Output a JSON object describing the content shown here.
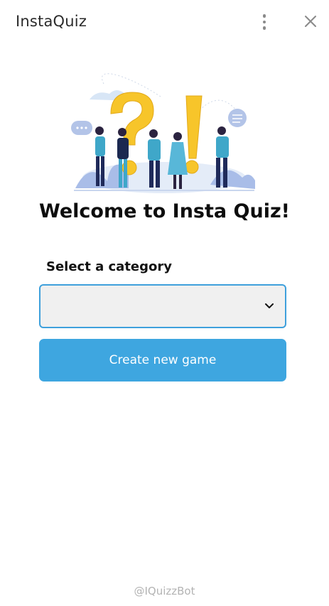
{
  "app": {
    "title": "InstaQuiz"
  },
  "header": {
    "menu_icon": "vertical-dots-icon",
    "close_icon": "close-icon"
  },
  "hero": {
    "illustration": "quiz-people-illustration"
  },
  "main": {
    "welcome_title": "Welcome to Insta Quiz!",
    "category_label": "Select a category",
    "category_select": {
      "selected_value": "",
      "icon": "chevron-down-icon"
    },
    "create_button_label": "Create new game"
  },
  "footer": {
    "handle": "@IQuizzBot"
  },
  "colors": {
    "accent": "#3ea6e0",
    "select_border": "#3ea0dc",
    "select_bg": "#f0f0f0",
    "question_mark": "#f7c52a"
  }
}
